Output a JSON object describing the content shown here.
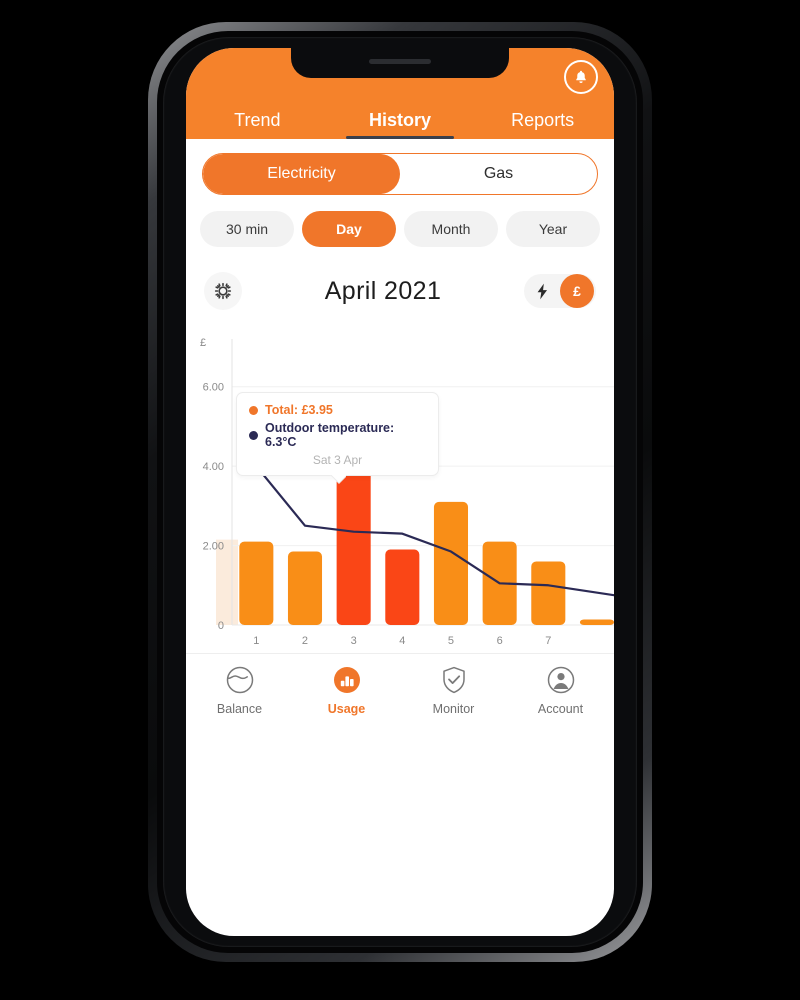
{
  "header": {
    "bell_icon": "bell-icon",
    "tabs": [
      {
        "label": "Trend",
        "active": false
      },
      {
        "label": "History",
        "active": true
      },
      {
        "label": "Reports",
        "active": false
      }
    ]
  },
  "fuel_toggle": {
    "options": [
      {
        "label": "Electricity",
        "active": true
      },
      {
        "label": "Gas",
        "active": false
      }
    ]
  },
  "period_selector": {
    "options": [
      {
        "label": "30 min",
        "active": false
      },
      {
        "label": "Day",
        "active": true
      },
      {
        "label": "Month",
        "active": false
      },
      {
        "label": "Year",
        "active": false
      }
    ]
  },
  "date_row": {
    "settings_icon": "gear-icon",
    "title": "April 2021",
    "unit_toggle": {
      "energy_icon": "lightning-bolt-icon",
      "money_label": "£",
      "active": "money"
    }
  },
  "tooltip": {
    "total_label": "Total: £3.95",
    "temp_label": "Outdoor temperature: 6.3°C",
    "date_label": "Sat 3 Apr",
    "total_color": "#F0762A",
    "temp_color": "#2b2a55"
  },
  "colors": {
    "brand_orange": "#F0762A",
    "header_orange": "#F5822B",
    "bar_weekday": "#F98E17",
    "bar_weekend": "#FA4616",
    "line_navy": "#2b2a55",
    "ghost_bar": "#FBEBDC"
  },
  "chart_data": {
    "type": "bar",
    "title": "April 2021",
    "xlabel": "",
    "ylabel": "£",
    "ylim": [
      0,
      7
    ],
    "yticks": [
      "0",
      "2.00",
      "4.00",
      "6.00"
    ],
    "ytick_values": [
      0,
      2,
      4,
      6
    ],
    "grid": true,
    "legend": "tooltip",
    "categories": [
      "1",
      "2",
      "3",
      "4",
      "5",
      "6",
      "7"
    ],
    "series": [
      {
        "name": "Total",
        "unit": "£",
        "type": "bar",
        "values": [
          2.1,
          1.85,
          3.95,
          1.9,
          3.1,
          2.1,
          1.6
        ],
        "colors": [
          "#F98E17",
          "#F98E17",
          "#FA4616",
          "#FA4616",
          "#F98E17",
          "#F98E17",
          "#F98E17"
        ]
      },
      {
        "name": "Outdoor temperature",
        "unit": "°C",
        "type": "line",
        "color": "#2b2a55",
        "axis": "right",
        "values": [
          4.0,
          2.5,
          2.35,
          2.3,
          1.85,
          1.05,
          1.0
        ]
      }
    ],
    "highlighted_index": 2,
    "partial_bar_right": true,
    "ghost_bar_left": true
  },
  "bottom_nav": {
    "items": [
      {
        "label": "Balance",
        "icon": "balance-circle-icon",
        "active": false
      },
      {
        "label": "Usage",
        "icon": "bar-chart-icon",
        "active": true
      },
      {
        "label": "Monitor",
        "icon": "shield-check-icon",
        "active": false
      },
      {
        "label": "Account",
        "icon": "person-circle-icon",
        "active": false
      }
    ]
  }
}
